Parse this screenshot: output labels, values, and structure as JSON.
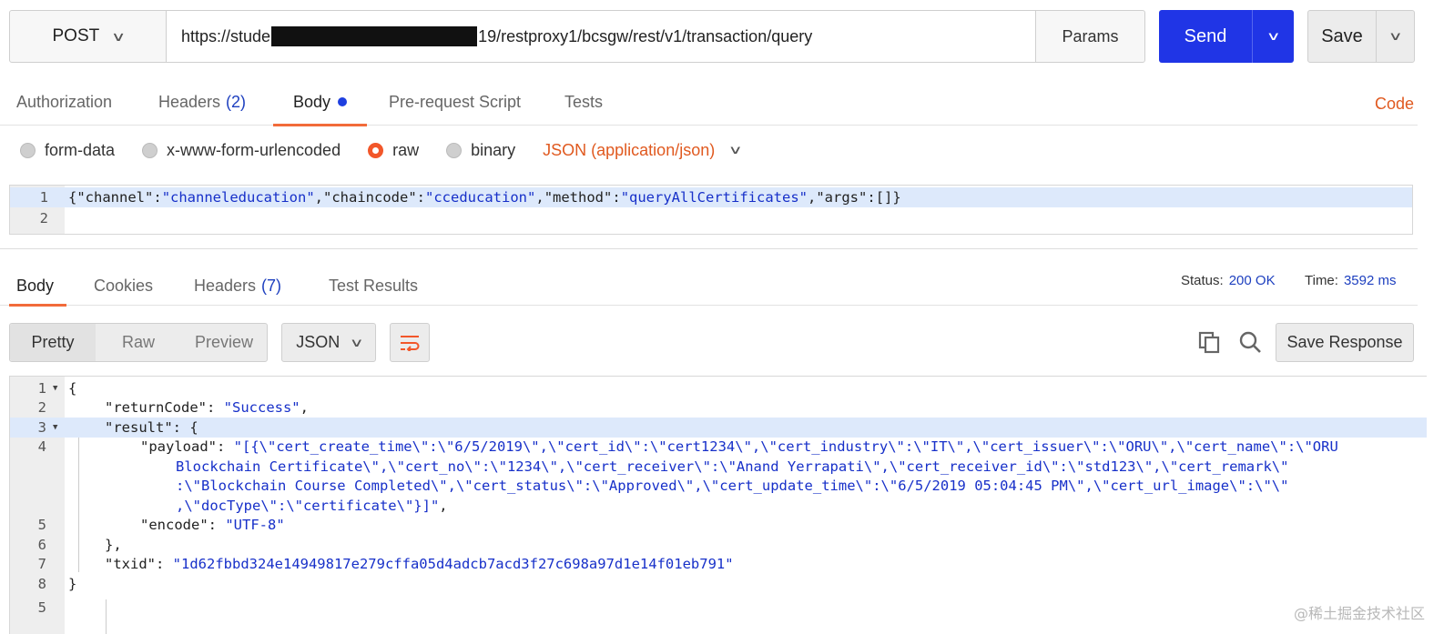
{
  "request": {
    "method": "POST",
    "url_prefix": "https://stude",
    "url_suffix": "19/restproxy1/bcsgw/rest/v1/transaction/query",
    "params_label": "Params",
    "send_label": "Send",
    "save_label": "Save"
  },
  "request_tabs": {
    "authorization": "Authorization",
    "headers": "Headers",
    "headers_count": "(2)",
    "body": "Body",
    "prerequest": "Pre-request Script",
    "tests": "Tests",
    "code": "Code"
  },
  "body_types": {
    "form_data": "form-data",
    "urlencoded": "x-www-form-urlencoded",
    "raw": "raw",
    "binary": "binary",
    "selected": "raw",
    "content_type": "JSON (application/json)"
  },
  "request_body": {
    "line_numbers": [
      "1",
      "2"
    ],
    "line1": {
      "open": "{",
      "k1": "\"channel\"",
      "v1": "\"channeleducation\"",
      "k2": "\"chaincode\"",
      "v2": "\"cceducation\"",
      "k3": "\"method\"",
      "v3": "\"queryAllCertificates\"",
      "k4": "\"args\"",
      "v4": "[]",
      "close": "}"
    }
  },
  "response_tabs": {
    "body": "Body",
    "cookies": "Cookies",
    "headers": "Headers",
    "headers_count": "(7)",
    "test_results": "Test Results"
  },
  "status": {
    "status_label": "Status:",
    "status_value": "200 OK",
    "time_label": "Time:",
    "time_value": "3592 ms"
  },
  "response_view": {
    "pretty": "Pretty",
    "raw": "Raw",
    "preview": "Preview",
    "format": "JSON",
    "save_response": "Save Response"
  },
  "response_body": {
    "line_numbers": [
      "1",
      "2",
      "3",
      "4",
      "5",
      "6",
      "7",
      "8",
      "5"
    ],
    "l1": "{",
    "l2_key": "\"returnCode\"",
    "l2_val": "\"Success\"",
    "l3_key": "\"result\"",
    "l3_rest": ": {",
    "l4_key": "\"payload\"",
    "l4_val_a": "\"[{\\\"cert_create_time\\\":\\\"6/5/2019\\\",\\\"cert_id\\\":\\\"cert1234\\\",\\\"cert_industry\\\":\\\"IT\\\",\\\"cert_issuer\\\":\\\"ORU\\\",\\\"cert_name\\\":\\\"ORU",
    "l4_val_b": "Blockchain Certificate\\\",\\\"cert_no\\\":\\\"1234\\\",\\\"cert_receiver\\\":\\\"Anand Yerrapati\\\",\\\"cert_receiver_id\\\":\\\"std123\\\",\\\"cert_remark\\\"",
    "l4_val_c": ":\\\"Blockchain Course Completed\\\",\\\"cert_status\\\":\\\"Approved\\\",\\\"cert_update_time\\\":\\\"6/5/2019 05:04:45 PM\\\",\\\"cert_url_image\\\":\\\"\\\"",
    "l4_val_d": ",\\\"docType\\\":\\\"certificate\\\"}]\"",
    "l5_key": "\"encode\"",
    "l5_val": "\"UTF-8\"",
    "l6": "},",
    "l7_key": "\"txid\"",
    "l7_val": "\"1d62fbbd324e14949817e279cffa05d4adcb7acd3f27c698a97d1e14f01eb791\"",
    "l8": "}"
  },
  "watermark": "@稀土掘金技术社区",
  "colors": {
    "accent": "#f26b3a",
    "send": "#2035e6",
    "json_string": "#1730c9",
    "link_blue": "#1d3fbf"
  }
}
